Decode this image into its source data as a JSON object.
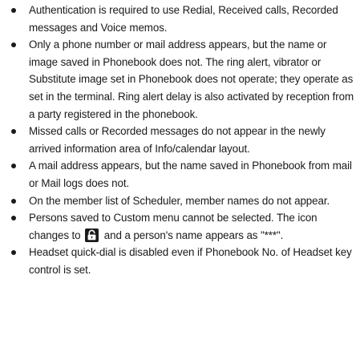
{
  "notes": [
    "Authentication is required to use Redial, Received calls, Recorded messages and Voice memos.",
    "Only a phone number or mail address appears, but the name or image saved in Phonebook does not. The ring alert, vibrator or Substitute image set in Phonebook does not operate; they operate as set in the terminal. Ring alert delay is also activated by reception from a party registered in the phonebook.",
    "Missed calls or Recorded messages do not appear in the newly arrived information area of Info/calendar layout.",
    "A mail address appears, but the name saved in Phonebook from mail or Mail logs does not.",
    "On the member list of Scheduler, member names do not appear.",
    "Headset quick-dial is disabled even if Phonebook No. of Headset key control is set."
  ],
  "custom_menu_note": {
    "before_icon": "Persons saved to Custom menu cannot be selected. The icon changes to",
    "icon": "lock-icon",
    "after_icon": "and a person's name appears as \"***\"."
  }
}
